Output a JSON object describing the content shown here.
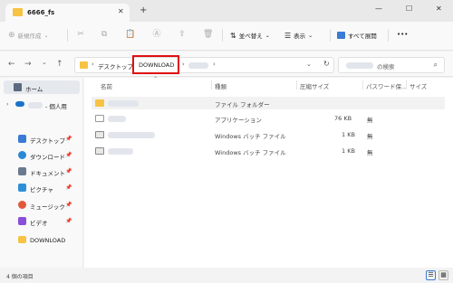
{
  "window": {
    "tab_title": "6666_fs",
    "tab_close": "✕",
    "new_tab": "+",
    "min": "—",
    "max": "☐",
    "close": "✕"
  },
  "toolbar": {
    "new_label": "新規作成",
    "sort_label": "並べ替え",
    "view_label": "表示",
    "expand_all_label": "すべて展開",
    "more": "•••"
  },
  "nav": {
    "back": "←",
    "forward": "→",
    "dropdown": "⌄",
    "up": "↑",
    "refresh": "↻"
  },
  "address": {
    "crumbs": [
      "デスクトップ",
      "DOWNLOAD"
    ],
    "chevron": "⌄"
  },
  "search": {
    "placeholder_suffix": "の検索"
  },
  "sidebar": {
    "home": "ホーム",
    "personal_suffix": "- 個人用",
    "items": [
      {
        "label": "デスクトップ",
        "color": "#3a7bd5"
      },
      {
        "label": "ダウンロード",
        "color": "#2b88d8"
      },
      {
        "label": "ドキュメント",
        "color": "#6b7a8f"
      },
      {
        "label": "ピクチャ",
        "color": "#2f8fd8"
      },
      {
        "label": "ミュージック",
        "color": "#e05a3a"
      },
      {
        "label": "ビデオ",
        "color": "#8a4fd8"
      },
      {
        "label": "DOWNLOAD",
        "color": "#f6c342"
      }
    ]
  },
  "columns": {
    "name": "名前",
    "type": "種類",
    "size": "圧縮サイズ",
    "password": "パスワード保...",
    "orig_size": "サイズ"
  },
  "files": [
    {
      "type": "ファイル フォルダー",
      "size": "",
      "password": "",
      "icon": "folder"
    },
    {
      "type": "アプリケーション",
      "size": "76 KB",
      "password": "無",
      "icon": "app"
    },
    {
      "type": "Windows バッチ ファイル",
      "size": "1 KB",
      "password": "無",
      "icon": "bat"
    },
    {
      "type": "Windows バッチ ファイル",
      "size": "1 KB",
      "password": "無",
      "icon": "bat"
    }
  ],
  "status": {
    "item_count": "4 個の項目"
  }
}
